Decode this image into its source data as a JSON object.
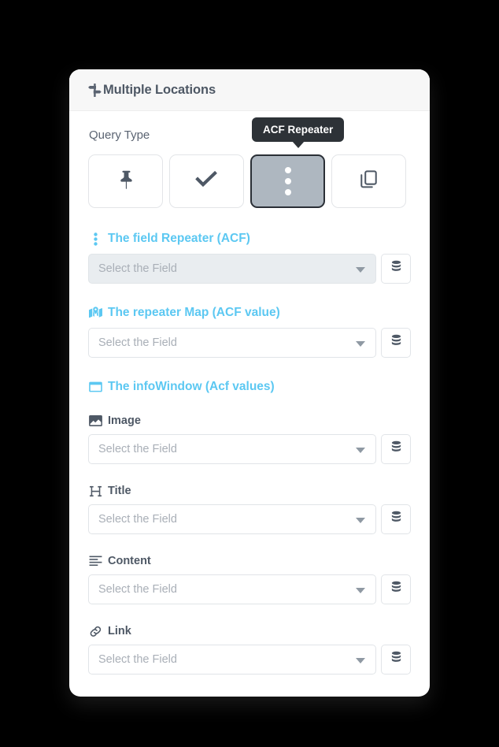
{
  "page": {
    "background_color": "#000000"
  },
  "card": {
    "header": {
      "icon": "signpost-icon",
      "title": "Multiple Locations"
    },
    "query_type": {
      "label": "Query Type",
      "tooltip": "ACF Repeater",
      "options": [
        {
          "icon": "pin-icon",
          "name": "single-location",
          "selected": false
        },
        {
          "icon": "double-check-icon",
          "name": "multiple-checked",
          "selected": false
        },
        {
          "icon": "vertical-dots-icon",
          "name": "acf-repeater",
          "selected": true
        },
        {
          "icon": "copy-icon",
          "name": "duplicate",
          "selected": false
        }
      ]
    },
    "sections": [
      {
        "icon": "vertical-dots-icon",
        "title": "The field Repeater (ACF)",
        "color": "#5cc8f2",
        "select": {
          "placeholder": "Select the Field",
          "value": "Select the Field",
          "disabled": true
        },
        "db_button_icon": "database-icon"
      },
      {
        "icon": "map-marked-icon",
        "title": "The repeater Map (ACF value)",
        "color": "#5cc8f2",
        "select": {
          "placeholder": "Select the Field",
          "value": "Select the Field",
          "disabled": false
        },
        "db_button_icon": "database-icon"
      }
    ],
    "infowindow": {
      "icon": "window-icon",
      "title": "The infoWindow (Acf values)",
      "color": "#5cc8f2",
      "fields": [
        {
          "icon": "image-icon",
          "label": "Image",
          "select": {
            "placeholder": "Select the Field",
            "value": "Select the Field",
            "disabled": false
          },
          "db_button_icon": "database-icon"
        },
        {
          "icon": "heading-h-icon",
          "label": "Title",
          "select": {
            "placeholder": "Select the Field",
            "value": "Select the Field",
            "disabled": false
          },
          "db_button_icon": "database-icon"
        },
        {
          "icon": "align-left-icon",
          "label": "Content",
          "select": {
            "placeholder": "Select the Field",
            "value": "Select the Field",
            "disabled": false
          },
          "db_button_icon": "database-icon"
        },
        {
          "icon": "link-icon",
          "label": "Link",
          "select": {
            "placeholder": "Select the Field",
            "value": "Select the Field",
            "disabled": false
          },
          "db_button_icon": "database-icon"
        }
      ]
    }
  },
  "theme": {
    "accent_blue": "#5cc8f2",
    "text_dark": "#4e5865",
    "placeholder_grey": "#a9afb7",
    "selected_button_bg": "#aeb7c0",
    "tooltip_bg": "#2d3237"
  }
}
